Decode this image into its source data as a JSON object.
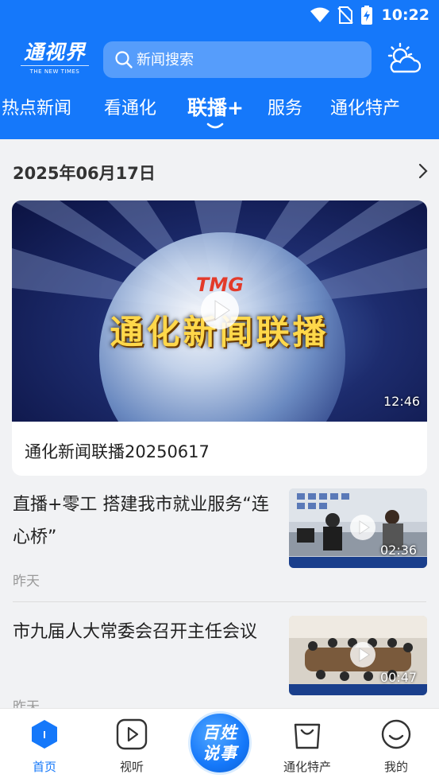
{
  "status_bar": {
    "time": "10:22"
  },
  "header": {
    "logo_text": "通视界",
    "logo_subtext": "THE NEW TIMES",
    "search_placeholder": "新闻搜索",
    "tabs": [
      {
        "label": "热点新闻",
        "active": false
      },
      {
        "label": "看通化",
        "active": false
      },
      {
        "label": "联播+",
        "active": true
      },
      {
        "label": "服务",
        "active": false
      },
      {
        "label": "通化特产",
        "active": false
      }
    ]
  },
  "date_section": {
    "date": "2025年06月17日"
  },
  "feature": {
    "overlay_logo": "TMG",
    "overlay_title": "通化新闻联播",
    "duration": "12:46",
    "title": "通化新闻联播20250617"
  },
  "news_list": [
    {
      "title": "直播+零工 搭建我市就业服务“连心桥”",
      "time": "昨天",
      "duration": "02:36"
    },
    {
      "title": "市九届人大常委会召开主任会议",
      "time": "昨天",
      "duration": "00:47"
    }
  ],
  "bottom_nav": {
    "items": [
      {
        "label": "首页",
        "active": true
      },
      {
        "label": "视听",
        "active": false
      },
      {
        "label": "通化特产",
        "active": false
      },
      {
        "label": "我的",
        "active": false
      }
    ],
    "center_button": {
      "line1": "百姓",
      "line2": "说事"
    }
  },
  "colors": {
    "brand_blue": "#1578fa",
    "background": "#f1f2f4"
  }
}
